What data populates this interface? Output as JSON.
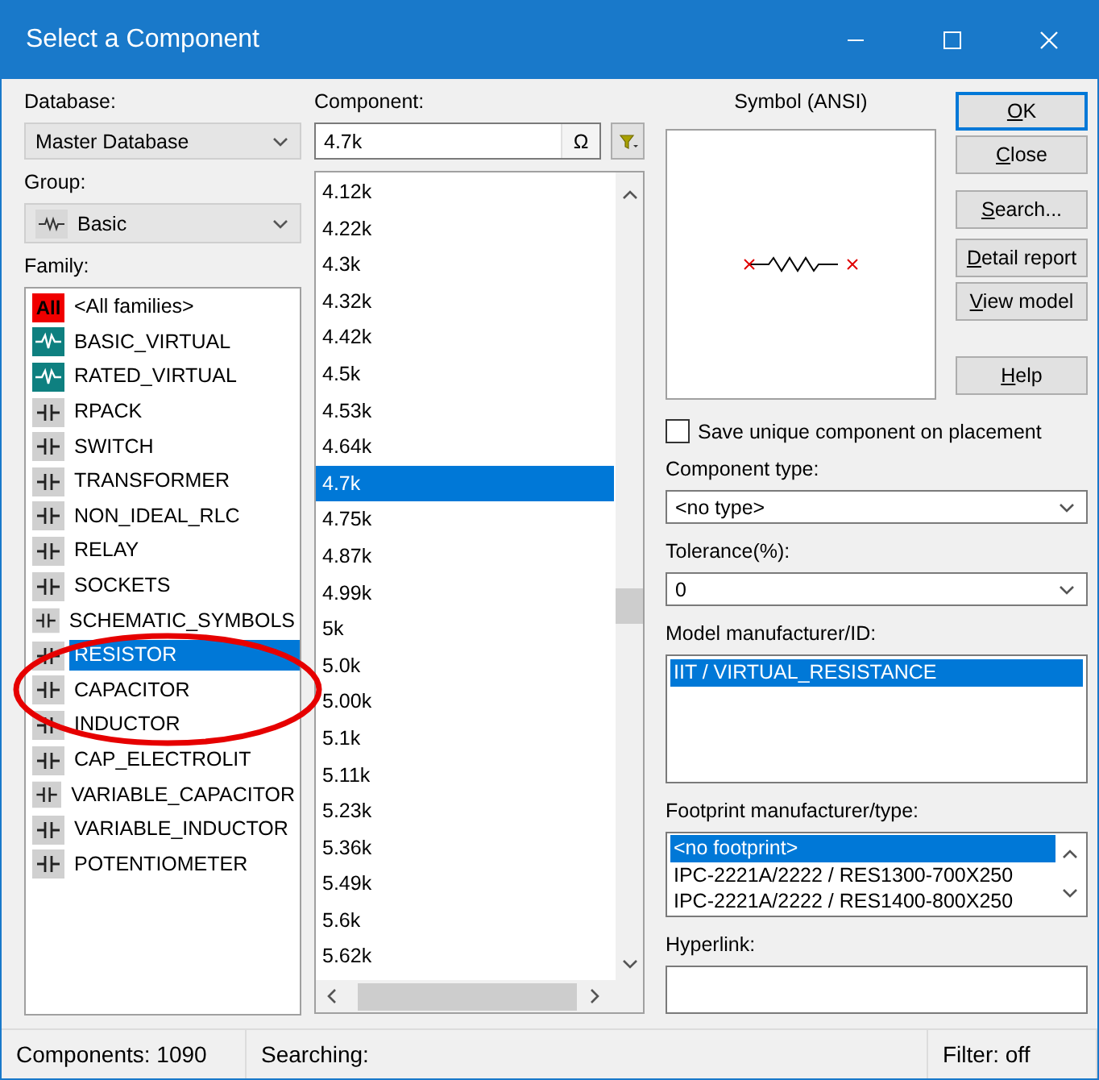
{
  "window": {
    "title": "Select a Component"
  },
  "database": {
    "label": "Database:",
    "value": "Master Database"
  },
  "group": {
    "label": "Group:",
    "value": "Basic"
  },
  "family": {
    "label": "Family:",
    "items": [
      {
        "kind": "all",
        "badge": "All",
        "label": "<All families>",
        "selected": false
      },
      {
        "kind": "virtual",
        "label": "BASIC_VIRTUAL",
        "selected": false
      },
      {
        "kind": "virtual",
        "label": "RATED_VIRTUAL",
        "selected": false
      },
      {
        "kind": "part",
        "label": "RPACK",
        "selected": false
      },
      {
        "kind": "part",
        "label": "SWITCH",
        "selected": false
      },
      {
        "kind": "part",
        "label": "TRANSFORMER",
        "selected": false
      },
      {
        "kind": "part",
        "label": "NON_IDEAL_RLC",
        "selected": false
      },
      {
        "kind": "part",
        "label": "RELAY",
        "selected": false
      },
      {
        "kind": "part",
        "label": "SOCKETS",
        "selected": false
      },
      {
        "kind": "part",
        "label": "SCHEMATIC_SYMBOLS",
        "selected": false
      },
      {
        "kind": "part",
        "label": "RESISTOR",
        "selected": true
      },
      {
        "kind": "part",
        "label": "CAPACITOR",
        "selected": false
      },
      {
        "kind": "part",
        "label": "INDUCTOR",
        "selected": false
      },
      {
        "kind": "part",
        "label": "CAP_ELECTROLIT",
        "selected": false
      },
      {
        "kind": "part",
        "label": "VARIABLE_CAPACITOR",
        "selected": false
      },
      {
        "kind": "part",
        "label": "VARIABLE_INDUCTOR",
        "selected": false
      },
      {
        "kind": "part",
        "label": "POTENTIOMETER",
        "selected": false
      }
    ]
  },
  "component": {
    "label": "Component:",
    "value": "4.7k",
    "symbol_button": "Ω",
    "items": [
      {
        "label": "4.12k",
        "selected": false
      },
      {
        "label": "4.22k",
        "selected": false
      },
      {
        "label": "4.3k",
        "selected": false
      },
      {
        "label": "4.32k",
        "selected": false
      },
      {
        "label": "4.42k",
        "selected": false
      },
      {
        "label": "4.5k",
        "selected": false
      },
      {
        "label": "4.53k",
        "selected": false
      },
      {
        "label": "4.64k",
        "selected": false
      },
      {
        "label": "4.7k",
        "selected": true
      },
      {
        "label": "4.75k",
        "selected": false
      },
      {
        "label": "4.87k",
        "selected": false
      },
      {
        "label": "4.99k",
        "selected": false
      },
      {
        "label": "5k",
        "selected": false
      },
      {
        "label": "5.0k",
        "selected": false
      },
      {
        "label": "5.00k",
        "selected": false
      },
      {
        "label": "5.1k",
        "selected": false
      },
      {
        "label": "5.11k",
        "selected": false
      },
      {
        "label": "5.23k",
        "selected": false
      },
      {
        "label": "5.36k",
        "selected": false
      },
      {
        "label": "5.49k",
        "selected": false
      },
      {
        "label": "5.6k",
        "selected": false
      },
      {
        "label": "5.62k",
        "selected": false
      }
    ]
  },
  "symbol": {
    "title": "Symbol (ANSI)"
  },
  "buttons": [
    {
      "key": "O",
      "rest": "K",
      "default": true
    },
    {
      "key": "C",
      "rest": "lose",
      "default": false
    },
    {
      "key": "S",
      "rest": "earch...",
      "default": false
    },
    {
      "key": "D",
      "rest": "etail report",
      "default": false
    },
    {
      "key": "V",
      "rest": "iew model",
      "default": false
    },
    {
      "key": "H",
      "rest": "elp",
      "default": false
    }
  ],
  "save_unique": {
    "label": "Save unique component on placement",
    "checked": false
  },
  "component_type": {
    "label": "Component type:",
    "value": "<no type>"
  },
  "tolerance": {
    "label": "Tolerance(%):",
    "value": "0"
  },
  "model": {
    "label": "Model manufacturer/ID:",
    "items": [
      {
        "label": "IIT / VIRTUAL_RESISTANCE",
        "selected": true
      }
    ]
  },
  "footprint": {
    "label": "Footprint manufacturer/type:",
    "items": [
      {
        "label": "<no footprint>",
        "selected": true
      },
      {
        "label": "IPC-2221A/2222 / RES1300-700X250",
        "selected": false
      },
      {
        "label": "IPC-2221A/2222 / RES1400-800X250",
        "selected": false
      }
    ]
  },
  "hyperlink": {
    "label": "Hyperlink:"
  },
  "status_bar": [
    "Components: 1090",
    "Searching:",
    "Filter: off"
  ],
  "annotation": {
    "kind": "ellipse"
  }
}
